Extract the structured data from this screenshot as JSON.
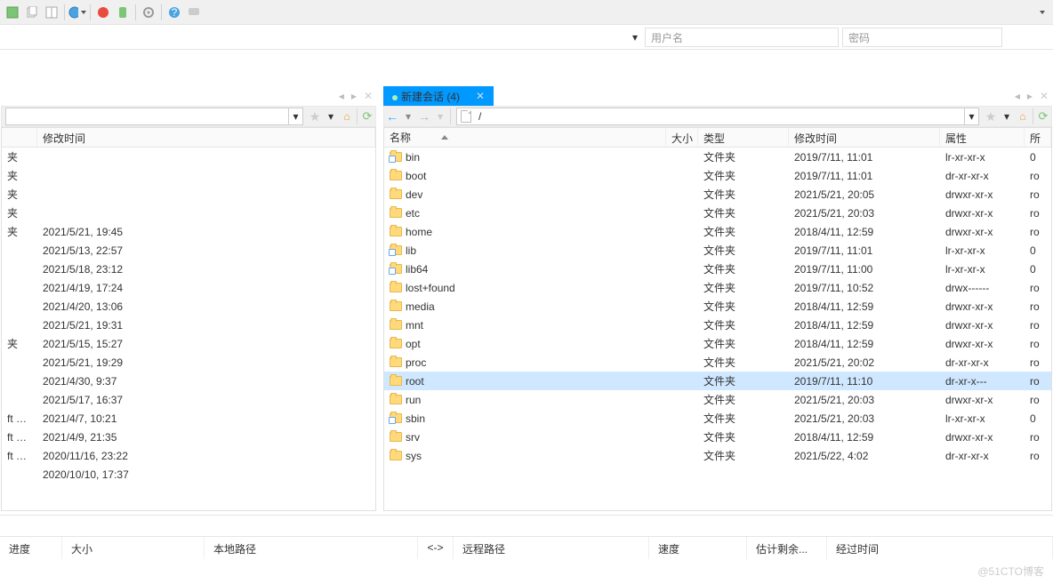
{
  "toolbar": {
    "icons": [
      "save-icon",
      "copy-icon",
      "files-icon",
      "globe-icon",
      "swirl-red-icon",
      "shield-green-icon",
      "gear-icon",
      "help-icon",
      "chat-icon"
    ]
  },
  "conn": {
    "user_placeholder": "用户名",
    "pass_placeholder": "密码"
  },
  "left": {
    "columns": {
      "date": "修改时间"
    },
    "rows": [
      {
        "name": "夹",
        "date": ""
      },
      {
        "name": "夹",
        "date": ""
      },
      {
        "name": "夹",
        "date": ""
      },
      {
        "name": "夹",
        "date": ""
      },
      {
        "name": "夹",
        "date": "2021/5/21, 19:45"
      },
      {
        "name": "",
        "date": "2021/5/13, 22:57"
      },
      {
        "name": "",
        "date": "2021/5/18, 23:12"
      },
      {
        "name": "",
        "date": "2021/4/19, 17:24"
      },
      {
        "name": "",
        "date": "2021/4/20, 13:06"
      },
      {
        "name": "",
        "date": "2021/5/21, 19:31"
      },
      {
        "name": "夹",
        "date": "2021/5/15, 15:27"
      },
      {
        "name": "",
        "date": "2021/5/21, 19:29"
      },
      {
        "name": "",
        "date": "2021/4/30, 9:37"
      },
      {
        "name": "",
        "date": "2021/5/17, 16:37"
      },
      {
        "name": "ft …",
        "date": "2021/4/7, 10:21"
      },
      {
        "name": "ft …",
        "date": "2021/4/9, 21:35"
      },
      {
        "name": "ft …",
        "date": "2020/11/16, 23:22"
      },
      {
        "name": "",
        "date": "2020/10/10, 17:37"
      }
    ]
  },
  "right": {
    "tab_label": "新建会话 (4)",
    "path": "/",
    "columns": {
      "name": "名称",
      "size": "大小",
      "type": "类型",
      "date": "修改时间",
      "perm": "属性",
      "own": "所"
    },
    "rows": [
      {
        "name": "bin",
        "type": "文件夹",
        "date": "2019/7/11, 11:01",
        "perm": "lr-xr-xr-x",
        "own": "0",
        "link": true
      },
      {
        "name": "boot",
        "type": "文件夹",
        "date": "2019/7/11, 11:01",
        "perm": "dr-xr-xr-x",
        "own": "ro",
        "link": false
      },
      {
        "name": "dev",
        "type": "文件夹",
        "date": "2021/5/21, 20:05",
        "perm": "drwxr-xr-x",
        "own": "ro",
        "link": false
      },
      {
        "name": "etc",
        "type": "文件夹",
        "date": "2021/5/21, 20:03",
        "perm": "drwxr-xr-x",
        "own": "ro",
        "link": false
      },
      {
        "name": "home",
        "type": "文件夹",
        "date": "2018/4/11, 12:59",
        "perm": "drwxr-xr-x",
        "own": "ro",
        "link": false
      },
      {
        "name": "lib",
        "type": "文件夹",
        "date": "2019/7/11, 11:01",
        "perm": "lr-xr-xr-x",
        "own": "0",
        "link": true
      },
      {
        "name": "lib64",
        "type": "文件夹",
        "date": "2019/7/11, 11:00",
        "perm": "lr-xr-xr-x",
        "own": "0",
        "link": true
      },
      {
        "name": "lost+found",
        "type": "文件夹",
        "date": "2019/7/11, 10:52",
        "perm": "drwx------",
        "own": "ro",
        "link": false
      },
      {
        "name": "media",
        "type": "文件夹",
        "date": "2018/4/11, 12:59",
        "perm": "drwxr-xr-x",
        "own": "ro",
        "link": false
      },
      {
        "name": "mnt",
        "type": "文件夹",
        "date": "2018/4/11, 12:59",
        "perm": "drwxr-xr-x",
        "own": "ro",
        "link": false
      },
      {
        "name": "opt",
        "type": "文件夹",
        "date": "2018/4/11, 12:59",
        "perm": "drwxr-xr-x",
        "own": "ro",
        "link": false
      },
      {
        "name": "proc",
        "type": "文件夹",
        "date": "2021/5/21, 20:02",
        "perm": "dr-xr-xr-x",
        "own": "ro",
        "link": false
      },
      {
        "name": "root",
        "type": "文件夹",
        "date": "2019/7/11, 11:10",
        "perm": "dr-xr-x---",
        "own": "ro",
        "link": false,
        "selected": true
      },
      {
        "name": "run",
        "type": "文件夹",
        "date": "2021/5/21, 20:03",
        "perm": "drwxr-xr-x",
        "own": "ro",
        "link": false
      },
      {
        "name": "sbin",
        "type": "文件夹",
        "date": "2021/5/21, 20:03",
        "perm": "lr-xr-xr-x",
        "own": "0",
        "link": true
      },
      {
        "name": "srv",
        "type": "文件夹",
        "date": "2018/4/11, 12:59",
        "perm": "drwxr-xr-x",
        "own": "ro",
        "link": false
      },
      {
        "name": "sys",
        "type": "文件夹",
        "date": "2021/5/22, 4:02",
        "perm": "dr-xr-xr-x",
        "own": "ro",
        "link": false
      }
    ]
  },
  "transfer_cols": {
    "progress": "进度",
    "size": "大小",
    "local": "本地路径",
    "arrow": "<->",
    "remote": "远程路径",
    "speed": "速度",
    "eta": "估计剩余...",
    "elapsed": "经过时间"
  },
  "watermark": "@51CTO博客"
}
